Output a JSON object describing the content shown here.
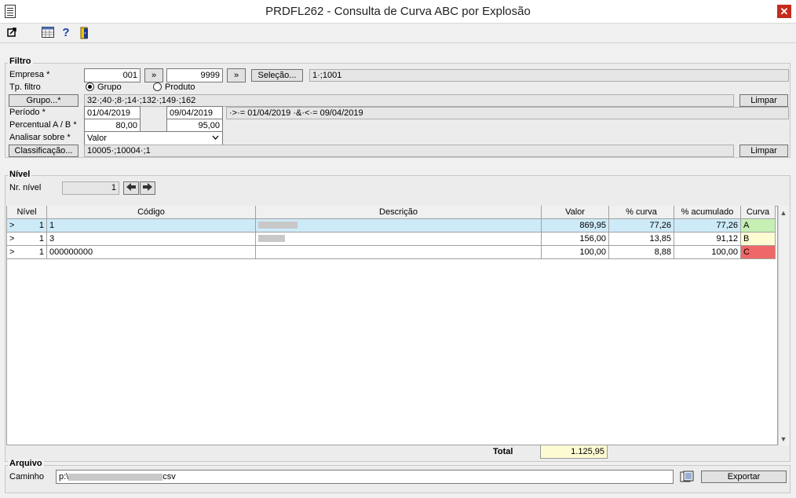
{
  "window": {
    "title": "PRDFL262 - Consulta de Curva ABC por Explosão",
    "close_glyph": "✕"
  },
  "toolbar": {
    "icons": [
      "export-icon",
      "calendar-grid-icon",
      "help-icon",
      "exit-door-icon"
    ]
  },
  "filtro": {
    "label": "Filtro",
    "empresa_label": "Empresa *",
    "empresa_from": "001",
    "empresa_to": "9999",
    "goto_glyph": "»",
    "selecao_label": "Seleção...",
    "selecao_value": "1·;1001",
    "tp_filtro_label": "Tp. filtro",
    "radio_grupo": "Grupo",
    "radio_produto": "Produto",
    "grupo_button": "Grupo...*",
    "grupo_value": "32·;40·;8·;14·;132·;149·;162",
    "limpar": "Limpar",
    "periodo_label": "Período *",
    "periodo_from": "01/04/2019",
    "periodo_to": "09/04/2019",
    "periodo_expr": "·>·= 01/04/2019 ·&·<·= 09/04/2019",
    "percentual_label": "Percentual A / B *",
    "percentual_a": "80,00",
    "percentual_b": "95,00",
    "analisar_label": "Analisar sobre *",
    "analisar_value": "Valor",
    "classificacao_button": "Classificação...",
    "classificacao_value": "10005·;10004·;1"
  },
  "nivel": {
    "label": "Nível",
    "nr_nivel_label": "Nr. nível",
    "nr_nivel_value": "1"
  },
  "grid": {
    "columns": [
      "Nível",
      "Código",
      "Descrição",
      "Valor",
      "% curva",
      "% acumulado",
      "Curva"
    ],
    "rows": [
      {
        "marker": ">",
        "nivel": "1",
        "codigo": "1",
        "valor": "869,95",
        "pct_curva": "77,26",
        "pct_acum": "77,26",
        "curva": "A",
        "color": "#c6efb4"
      },
      {
        "marker": ">",
        "nivel": "1",
        "codigo": "3",
        "valor": "156,00",
        "pct_curva": "13,85",
        "pct_acum": "91,12",
        "curva": "B",
        "color": "#fdfbd2"
      },
      {
        "marker": ">",
        "nivel": "1",
        "codigo": "000000000",
        "valor": "100,00",
        "pct_curva": "8,88",
        "pct_acum": "100,00",
        "curva": "C",
        "color": "#f06767"
      }
    ]
  },
  "total": {
    "label": "Total",
    "value": "1.125,95"
  },
  "arquivo": {
    "label": "Arquivo",
    "caminho_label": "Caminho",
    "caminho_prefix": "p:\\",
    "caminho_suffix": "csv",
    "exportar": "Exportar"
  }
}
